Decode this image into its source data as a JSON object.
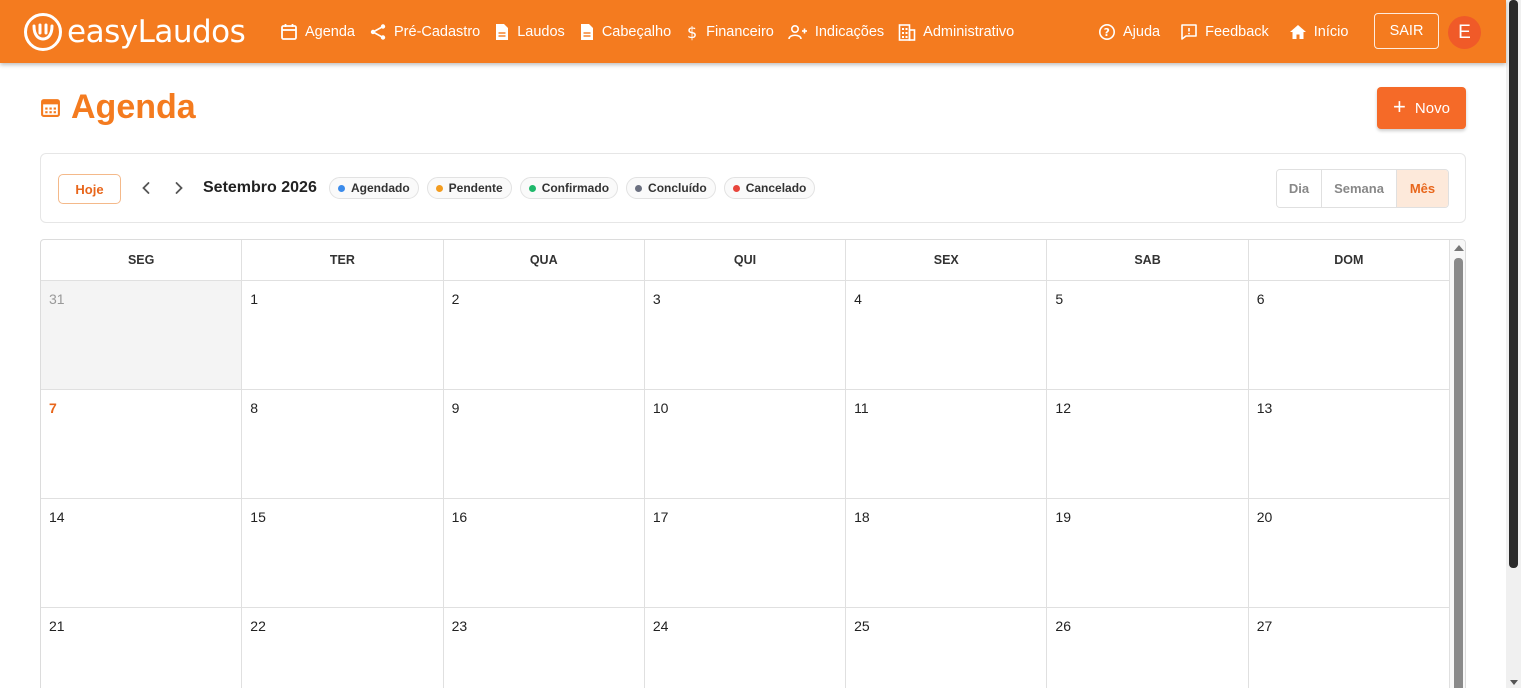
{
  "brand": {
    "name": "easyLaudos",
    "color": "#f47b1f"
  },
  "nav": [
    {
      "label": "Agenda",
      "icon": "calendar-icon"
    },
    {
      "label": "Pré-Cadastro",
      "icon": "share-icon"
    },
    {
      "label": "Laudos",
      "icon": "document-icon"
    },
    {
      "label": "Cabeçalho",
      "icon": "document-icon"
    },
    {
      "label": "Financeiro",
      "icon": "dollar-icon"
    },
    {
      "label": "Indicações",
      "icon": "user-plus-icon"
    },
    {
      "label": "Administrativo",
      "icon": "building-icon"
    }
  ],
  "right_nav": [
    {
      "label": "Ajuda",
      "icon": "help-icon"
    },
    {
      "label": "Feedback",
      "icon": "feedback-icon"
    },
    {
      "label": "Início",
      "icon": "home-icon"
    }
  ],
  "sair_label": "SAIR",
  "avatar_letter": "E",
  "page": {
    "title": "Agenda",
    "new_button": "Novo"
  },
  "toolbar": {
    "today": "Hoje",
    "month": "Setembro 2026",
    "legend": [
      {
        "label": "Agendado",
        "color": "#3b8beb"
      },
      {
        "label": "Pendente",
        "color": "#f39c1f"
      },
      {
        "label": "Confirmado",
        "color": "#1fb86b"
      },
      {
        "label": "Concluído",
        "color": "#6b7080"
      },
      {
        "label": "Cancelado",
        "color": "#e8453c"
      }
    ],
    "views": [
      "Dia",
      "Semana",
      "Mês"
    ],
    "active_view": "Mês"
  },
  "calendar": {
    "weekdays": [
      "SEG",
      "TER",
      "QUA",
      "QUI",
      "SEX",
      "SAB",
      "DOM"
    ],
    "weeks": [
      [
        "31",
        "1",
        "2",
        "3",
        "4",
        "5",
        "6"
      ],
      [
        "7",
        "8",
        "9",
        "10",
        "11",
        "12",
        "13"
      ],
      [
        "14",
        "15",
        "16",
        "17",
        "18",
        "19",
        "20"
      ],
      [
        "21",
        "22",
        "23",
        "24",
        "25",
        "26",
        "27"
      ]
    ],
    "other_month_days": [
      "31"
    ],
    "today": "7"
  }
}
